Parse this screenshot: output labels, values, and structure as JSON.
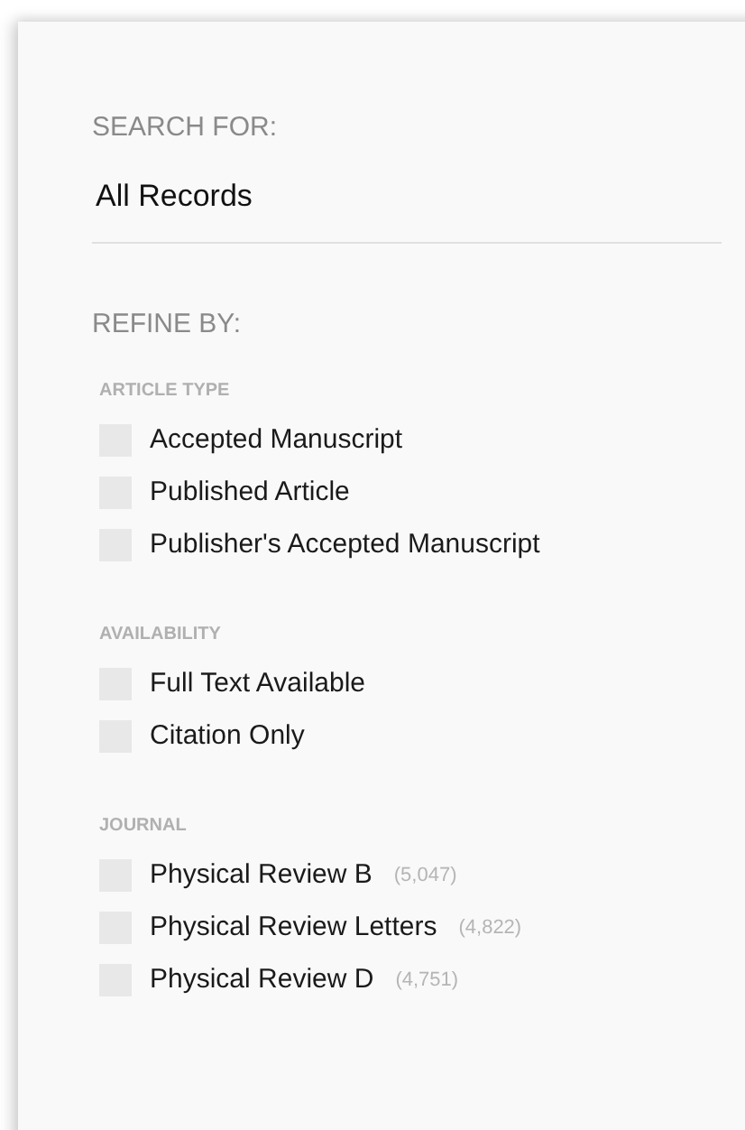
{
  "search_for": {
    "label": "SEARCH FOR:",
    "value": "All Records"
  },
  "refine_by": {
    "label": "REFINE BY:"
  },
  "facets": [
    {
      "title": "ARTICLE TYPE",
      "options": [
        {
          "label": "Accepted Manuscript",
          "checked": false
        },
        {
          "label": "Published Article",
          "checked": false
        },
        {
          "label": "Publisher's Accepted Manuscript",
          "checked": false
        }
      ]
    },
    {
      "title": "AVAILABILITY",
      "options": [
        {
          "label": "Full Text Available",
          "checked": false
        },
        {
          "label": "Citation Only",
          "checked": false
        }
      ]
    },
    {
      "title": "JOURNAL",
      "options": [
        {
          "label": "Physical Review B",
          "count": "(5,047)",
          "checked": false
        },
        {
          "label": "Physical Review Letters",
          "count": "(4,822)",
          "checked": false
        },
        {
          "label": "Physical Review D",
          "count": "(4,751)",
          "checked": false
        }
      ]
    }
  ]
}
